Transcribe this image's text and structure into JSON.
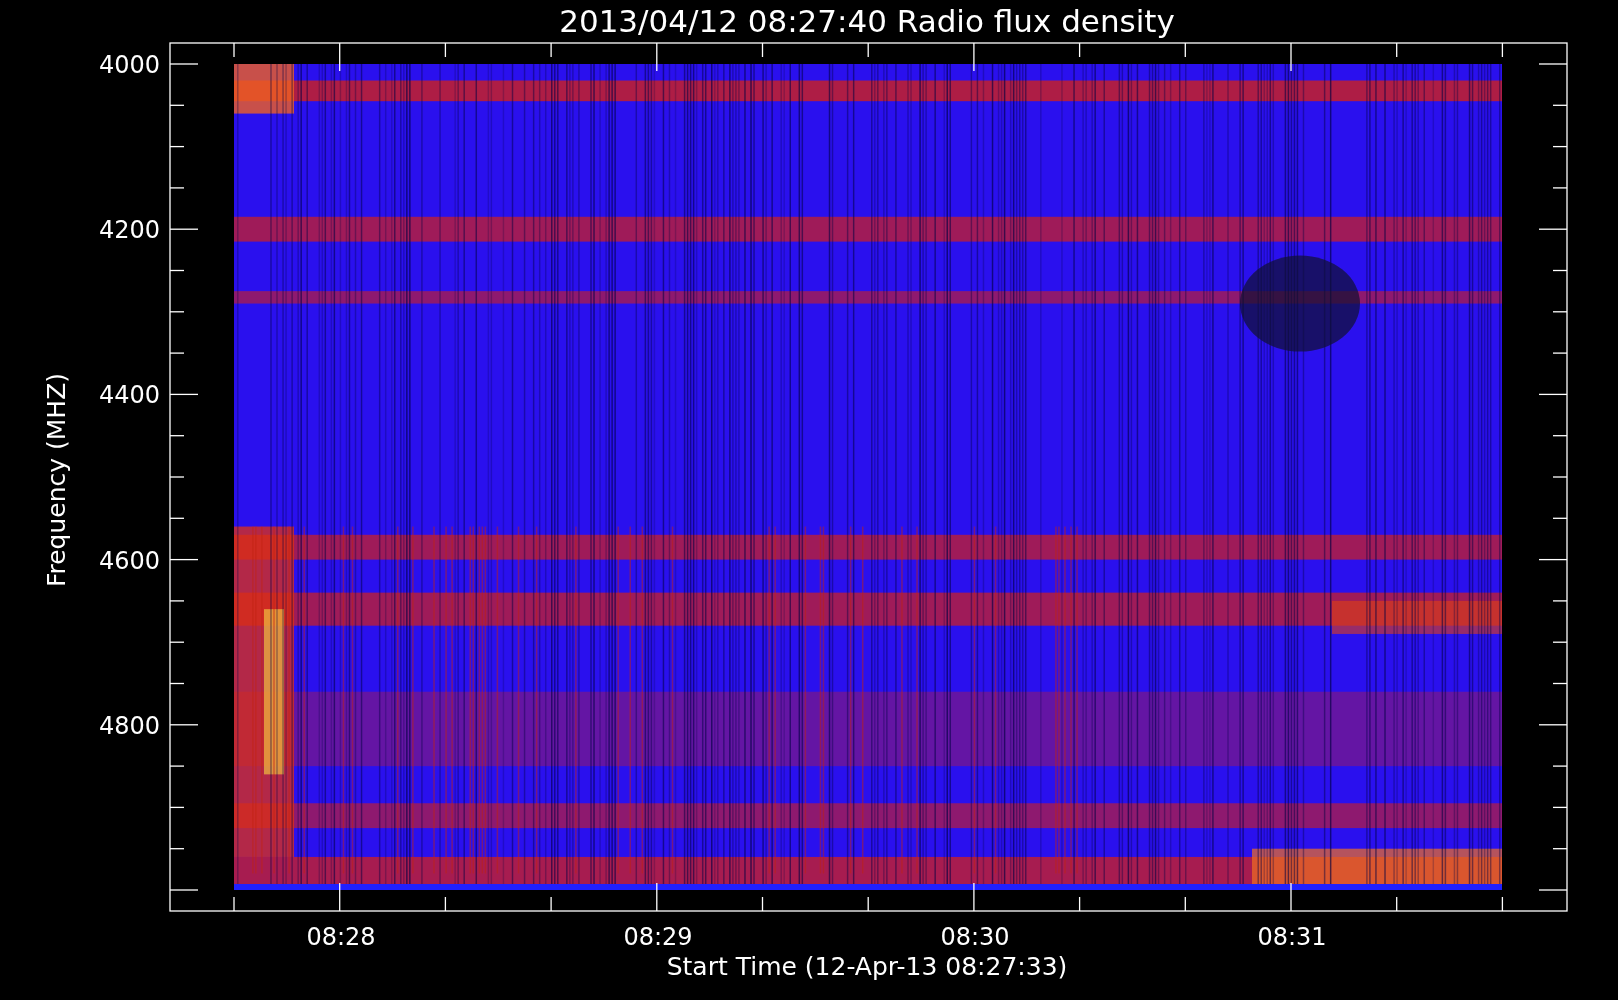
{
  "plot": {
    "title": "2013/04/12 08:27:40 Radio flux density",
    "ylabel": "Frequency (MHZ)",
    "xlabel": "Start Time (12-Apr-13 08:27:33)",
    "yticks": [
      "4000",
      "4200",
      "4400",
      "4600",
      "4800"
    ],
    "xticks": [
      "08:28",
      "08:29",
      "08:30",
      "08:31"
    ]
  }
}
